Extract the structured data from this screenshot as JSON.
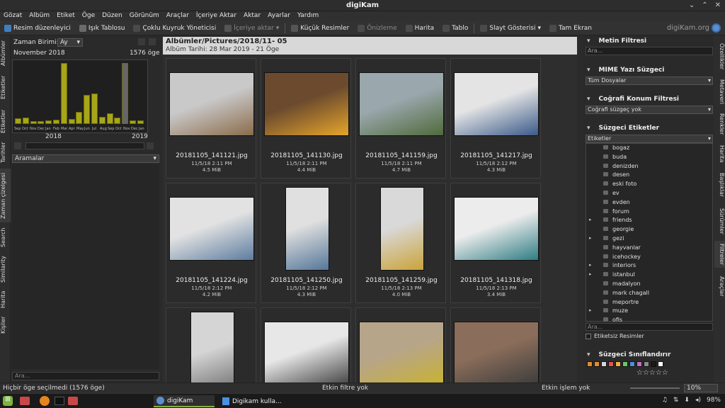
{
  "window": {
    "title": "digiKam",
    "btn_min": "⌄",
    "btn_max": "⌃",
    "btn_close": "✕"
  },
  "menu": [
    "Gözat",
    "Albüm",
    "Etiket",
    "Öge",
    "Düzen",
    "Görünüm",
    "Araçlar",
    "İçeriye Aktar",
    "Aktar",
    "Ayarlar",
    "Yardım"
  ],
  "toolbar": {
    "image_editor": "Resim düzenleyici",
    "light_table": "Işık Tablosu",
    "batch_queue": "Çoklu Kuyruk Yöneticisi",
    "import": "İçeriye aktar",
    "small_images": "Küçük Resimler",
    "preview": "Önizleme",
    "map": "Harita",
    "table": "Tablo",
    "slideshow": "Slayt Gösterisi",
    "fullscreen": "Tam Ekran",
    "brand": "digiKam.org"
  },
  "left_tabs": [
    "Albümler",
    "Etiketler",
    "Etiketler",
    "Tarihler",
    "Zaman çizelgesi",
    "Search",
    "Similarity",
    "Harita",
    "Kişiler"
  ],
  "timeline": {
    "unit_label": "Zaman Birimi:",
    "unit_value": "Ay",
    "month_label": "November 2018",
    "count_label": "1576 öge",
    "month_ticks": [
      "Sep",
      "Oct",
      "Nov",
      "Dec",
      "Jan",
      "Feb",
      "Mar",
      "Apr",
      "May",
      "Jun",
      "Jul",
      "Aug",
      "Sep",
      "Oct",
      "Nov",
      "Dec",
      "Jan"
    ],
    "year_left": "2018",
    "year_right": "2019",
    "bar_levels": [
      0.09,
      0.1,
      0.05,
      0.05,
      0.06,
      0.07,
      1.0,
      0.08,
      0.2,
      0.48,
      0.5,
      0.12,
      0.18,
      0.11,
      1.0,
      0.06,
      0.06
    ],
    "selected_index": 14,
    "searches_label": "Aramalar",
    "search_placeholder": "Ara..."
  },
  "album": {
    "path": "Albümler/Pictures/2018/11- 05",
    "date_line": "Albüm Tarihi: 28 Mar 2019 - 21 Öge"
  },
  "thumbnails": [
    {
      "name": "20181105_141121.jpg",
      "date": "11/5/18 2:11 PM",
      "size": "4.5 MiB",
      "orient": "land",
      "c1": "#c9c9c9",
      "c2": "#8b6b4a"
    },
    {
      "name": "20181105_141130.jpg",
      "date": "11/5/18 2:11 PM",
      "size": "4.4 MiB",
      "orient": "land",
      "c1": "#6b4a2e",
      "c2": "#e6a52a"
    },
    {
      "name": "20181105_141159.jpg",
      "date": "11/5/18 2:11 PM",
      "size": "4.7 MiB",
      "orient": "land",
      "c1": "#9aa7ad",
      "c2": "#4f6b3a"
    },
    {
      "name": "20181105_141217.jpg",
      "date": "11/5/18 2:12 PM",
      "size": "4.3 MiB",
      "orient": "land",
      "c1": "#e4e4e4",
      "c2": "#3b5a8a"
    },
    {
      "name": "20181105_141224.jpg",
      "date": "11/5/18 2:12 PM",
      "size": "4.2 MiB",
      "orient": "land",
      "c1": "#e2e2e2",
      "c2": "#5d7da0"
    },
    {
      "name": "20181105_141250.jpg",
      "date": "11/5/18 2:12 PM",
      "size": "4.3 MiB",
      "orient": "portrait",
      "c1": "#e0e0e0",
      "c2": "#557799"
    },
    {
      "name": "20181105_141259.jpg",
      "date": "11/5/18 2:13 PM",
      "size": "4.0 MiB",
      "orient": "portrait",
      "c1": "#d9d9d9",
      "c2": "#caa33a"
    },
    {
      "name": "20181105_141318.jpg",
      "date": "11/5/18 2:13 PM",
      "size": "3.4 MiB",
      "orient": "land",
      "c1": "#ececec",
      "c2": "#2f7d84"
    },
    {
      "name": "",
      "date": "",
      "size": "",
      "orient": "portrait",
      "c1": "#d5d5d5",
      "c2": "#6a6a6a"
    },
    {
      "name": "",
      "date": "",
      "size": "",
      "orient": "land",
      "c1": "#e7e7e7",
      "c2": "#444444"
    },
    {
      "name": "",
      "date": "",
      "size": "",
      "orient": "land",
      "c1": "#b7a58a",
      "c2": "#c8b232"
    },
    {
      "name": "",
      "date": "",
      "size": "",
      "orient": "land",
      "c1": "#8a6d5a",
      "c2": "#3c3c3c"
    }
  ],
  "right_panel": {
    "text_filter": "Metin Filtresi",
    "text_placeholder": "Ara...",
    "mime_filter": "MIME Yazı Süzgeci",
    "mime_value": "Tüm Dosyalar",
    "geo_filter": "Coğrafi Konum Filtresi",
    "geo_value": "Coğrafi süzgeç yok",
    "tag_filter": "Süzgeci Etiketler",
    "tag_root": "Etiketler",
    "tags": [
      {
        "name": "bogaz",
        "arrow": ""
      },
      {
        "name": "buda",
        "arrow": ""
      },
      {
        "name": "denizden",
        "arrow": ""
      },
      {
        "name": "desen",
        "arrow": ""
      },
      {
        "name": "eski foto",
        "arrow": ""
      },
      {
        "name": "ev",
        "arrow": ""
      },
      {
        "name": "evden",
        "arrow": ""
      },
      {
        "name": "forum",
        "arrow": ""
      },
      {
        "name": "friends",
        "arrow": "▸"
      },
      {
        "name": "georgie",
        "arrow": ""
      },
      {
        "name": "gezi",
        "arrow": "▸"
      },
      {
        "name": "hayvanlar",
        "arrow": ""
      },
      {
        "name": "icehockey",
        "arrow": ""
      },
      {
        "name": "interiors",
        "arrow": "▸"
      },
      {
        "name": "istanbul",
        "arrow": "▸"
      },
      {
        "name": "madalyon",
        "arrow": ""
      },
      {
        "name": "mark chagall",
        "arrow": ""
      },
      {
        "name": "meportre",
        "arrow": ""
      },
      {
        "name": "muze",
        "arrow": "▸"
      },
      {
        "name": "ofis",
        "arrow": ""
      }
    ],
    "tag_search_placeholder": "Ara...",
    "untagged": "Etiketsiz Resimler",
    "rating_filter": "Süzgeci Sınıflandırır",
    "color_labels": [
      "#e08b2c",
      "#e08b2c",
      "#d5d5d5",
      "#e35252",
      "#e8b23c",
      "#6cc36c",
      "#4f8fd6",
      "#c56cc5",
      "#8a8a8a",
      "#1a1a1a",
      "#ffffff"
    ],
    "stars": "☆☆☆☆☆"
  },
  "right_tabs": [
    "Özellikler",
    "Metaveri",
    "Renkler",
    "Harita",
    "Başlıklar",
    "Sürümler",
    "Filtreler",
    "Araçlar"
  ],
  "status": {
    "left": "Hiçbir öge seçilmedi (1576 öge)",
    "filter": "Etkin filtre yok",
    "process": "Etkin işlem yok",
    "zoom": "10%"
  },
  "taskbar": {
    "app1": "digiKam",
    "app2": "Digikam kulla...",
    "battery": "98%",
    "menu_icon": "⊞"
  }
}
